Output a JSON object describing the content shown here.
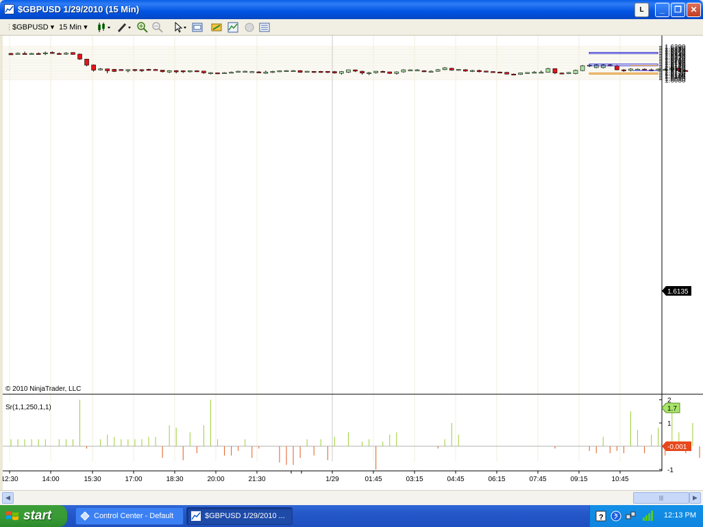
{
  "window": {
    "title": "$GBPUSD  1/29/2010 (15 Min)",
    "l_button": "L",
    "minimize": "_",
    "maximize": "❐",
    "close": "✕"
  },
  "toolbar": {
    "instrument": "$GBPUSD",
    "interval": "15 Min",
    "icons": [
      "candlestick-style-icon",
      "draw-pencil-icon",
      "zoom-in-icon",
      "zoom-out-icon",
      "pointer-icon",
      "data-box-icon",
      "strategies-icon",
      "indicators-icon",
      "properties-icon",
      "chart-trader-icon"
    ]
  },
  "chart": {
    "copyright": "© 2010 NinjaTrader, LLC",
    "indicator_label": "Sr(1,1,250,1,1)",
    "current_price": "1.6135",
    "indicator_pos_value": "1.7",
    "indicator_neg_value": "-0.001",
    "colors": {
      "up": "#a6e3a1",
      "down": "#e0161a",
      "rect_blue": "#2b2bd9",
      "rect_orange": "#e08a17",
      "hist_up": "#9acd32",
      "hist_down": "#e25a1c"
    }
  },
  "chart_data": {
    "type": "candlestick",
    "y_ticks": [
      "1.6290",
      "1.6280",
      "1.6270",
      "1.6260",
      "1.6250",
      "1.6240",
      "1.6230",
      "1.6220",
      "1.6210",
      "1.6200",
      "1.6190",
      "1.6180",
      "1.6170",
      "1.6160",
      "1.6150",
      "1.6140",
      "1.6130",
      "1.6120",
      "1.6110",
      "1.6100",
      "1.6090",
      "1.6080"
    ],
    "x_ticks": [
      "12:30",
      "14:00",
      "15:30",
      "17:00",
      "18:30",
      "20:00",
      "21:30",
      "1/29",
      "01:45",
      "03:15",
      "04:45",
      "06:15",
      "07:45",
      "09:15",
      "10:45"
    ],
    "indicator_y_ticks": [
      "2",
      "1",
      "-1"
    ],
    "ylim": [
      1.6075,
      1.6295
    ],
    "candles": [
      [
        1.6246,
        1.625,
        1.6236,
        1.6238
      ],
      [
        1.624,
        1.6252,
        1.6238,
        1.6247
      ],
      [
        1.6246,
        1.6258,
        1.6242,
        1.6245
      ],
      [
        1.6245,
        1.625,
        1.624,
        1.6246
      ],
      [
        1.6246,
        1.6252,
        1.6242,
        1.6245
      ],
      [
        1.6245,
        1.6258,
        1.6236,
        1.625
      ],
      [
        1.6253,
        1.6259,
        1.6244,
        1.6246
      ],
      [
        1.6246,
        1.6252,
        1.624,
        1.6244
      ],
      [
        1.6242,
        1.6254,
        1.6238,
        1.6248
      ],
      [
        1.6252,
        1.6254,
        1.6238,
        1.624
      ],
      [
        1.6242,
        1.6245,
        1.6206,
        1.621
      ],
      [
        1.621,
        1.6212,
        1.6165,
        1.6172
      ],
      [
        1.6173,
        1.6176,
        1.6131,
        1.614
      ],
      [
        1.6142,
        1.6153,
        1.6138,
        1.6148
      ],
      [
        1.6148,
        1.615,
        1.612,
        1.6136
      ],
      [
        1.6145,
        1.6148,
        1.6128,
        1.6132
      ],
      [
        1.6144,
        1.6146,
        1.6136,
        1.614
      ],
      [
        1.6138,
        1.6146,
        1.6126,
        1.6143
      ],
      [
        1.6144,
        1.6147,
        1.6132,
        1.614
      ],
      [
        1.6143,
        1.6146,
        1.6128,
        1.614
      ],
      [
        1.6145,
        1.6149,
        1.6137,
        1.6141
      ],
      [
        1.6144,
        1.6148,
        1.614,
        1.6141
      ],
      [
        1.614,
        1.6142,
        1.6125,
        1.613
      ],
      [
        1.6128,
        1.614,
        1.6122,
        1.6137
      ],
      [
        1.6137,
        1.614,
        1.612,
        1.6129
      ],
      [
        1.6136,
        1.6138,
        1.6122,
        1.613
      ],
      [
        1.6131,
        1.6138,
        1.6125,
        1.6136
      ],
      [
        1.6136,
        1.6139,
        1.613,
        1.6133
      ],
      [
        1.6134,
        1.6135,
        1.6117,
        1.6123
      ],
      [
        1.6121,
        1.6127,
        1.6113,
        1.6124
      ],
      [
        1.6123,
        1.6124,
        1.612,
        1.6122
      ],
      [
        1.6124,
        1.6127,
        1.6118,
        1.6124
      ],
      [
        1.6125,
        1.6131,
        1.6122,
        1.6127
      ],
      [
        1.6128,
        1.6136,
        1.6126,
        1.6133
      ],
      [
        1.6132,
        1.6137,
        1.6127,
        1.6133
      ],
      [
        1.6131,
        1.6134,
        1.613,
        1.6131
      ],
      [
        1.6129,
        1.6134,
        1.6122,
        1.6128
      ],
      [
        1.612,
        1.6137,
        1.6117,
        1.6128
      ],
      [
        1.6128,
        1.6136,
        1.6122,
        1.6132
      ],
      [
        1.6133,
        1.6138,
        1.6128,
        1.6136
      ],
      [
        1.6137,
        1.614,
        1.6132,
        1.6137
      ],
      [
        1.6137,
        1.6141,
        1.6131,
        1.6137
      ],
      [
        1.6137,
        1.6139,
        1.6124,
        1.6126
      ],
      [
        1.6129,
        1.6135,
        1.6126,
        1.6133
      ],
      [
        1.6132,
        1.6134,
        1.6123,
        1.6129
      ],
      [
        1.6132,
        1.6135,
        1.6123,
        1.6126
      ],
      [
        1.6132,
        1.6134,
        1.6122,
        1.6128
      ],
      [
        1.6131,
        1.6135,
        1.6118,
        1.6122
      ],
      [
        1.612,
        1.6134,
        1.6112,
        1.6131
      ],
      [
        1.6126,
        1.6144,
        1.6122,
        1.6142
      ],
      [
        1.6142,
        1.6143,
        1.6128,
        1.6134
      ],
      [
        1.6133,
        1.6136,
        1.6112,
        1.6122
      ],
      [
        1.6122,
        1.6129,
        1.6109,
        1.6124
      ],
      [
        1.6124,
        1.6134,
        1.6119,
        1.6133
      ],
      [
        1.6132,
        1.6137,
        1.6126,
        1.6129
      ],
      [
        1.6129,
        1.613,
        1.6117,
        1.6119
      ],
      [
        1.6119,
        1.6132,
        1.6112,
        1.6129
      ],
      [
        1.6129,
        1.6146,
        1.6124,
        1.6142
      ],
      [
        1.6142,
        1.6145,
        1.6137,
        1.6142
      ],
      [
        1.6142,
        1.6146,
        1.6137,
        1.6142
      ],
      [
        1.6136,
        1.6139,
        1.6128,
        1.6134
      ],
      [
        1.6132,
        1.6138,
        1.6127,
        1.6133
      ],
      [
        1.6133,
        1.6147,
        1.613,
        1.6143
      ],
      [
        1.6143,
        1.6159,
        1.614,
        1.6155
      ],
      [
        1.6152,
        1.6155,
        1.6137,
        1.614
      ],
      [
        1.6139,
        1.6147,
        1.6136,
        1.6145
      ],
      [
        1.6143,
        1.6146,
        1.613,
        1.6134
      ],
      [
        1.6134,
        1.6142,
        1.6128,
        1.6138
      ],
      [
        1.6138,
        1.6143,
        1.6126,
        1.613
      ],
      [
        1.6134,
        1.6136,
        1.6128,
        1.6131
      ],
      [
        1.6131,
        1.6133,
        1.6124,
        1.6128
      ],
      [
        1.6128,
        1.6131,
        1.6122,
        1.6126
      ],
      [
        1.6126,
        1.6128,
        1.6113,
        1.6115
      ],
      [
        1.6115,
        1.6118,
        1.6111,
        1.6114
      ],
      [
        1.6113,
        1.6125,
        1.611,
        1.6123
      ],
      [
        1.6123,
        1.6126,
        1.6117,
        1.6125
      ],
      [
        1.6125,
        1.6134,
        1.612,
        1.6127
      ],
      [
        1.6127,
        1.6137,
        1.6123,
        1.6127
      ],
      [
        1.6126,
        1.6155,
        1.6124,
        1.615
      ],
      [
        1.615,
        1.6151,
        1.6115,
        1.6122
      ],
      [
        1.6122,
        1.6125,
        1.6117,
        1.612
      ],
      [
        1.6118,
        1.6128,
        1.6115,
        1.6125
      ],
      [
        1.6118,
        1.6143,
        1.6114,
        1.6139
      ],
      [
        1.6137,
        1.6173,
        1.6134,
        1.6168
      ],
      [
        1.6166,
        1.6176,
        1.616,
        1.6172
      ],
      [
        1.6156,
        1.6178,
        1.6152,
        1.6173
      ],
      [
        1.6156,
        1.6178,
        1.6151,
        1.6173
      ],
      [
        1.6173,
        1.6179,
        1.617,
        1.6169
      ],
      [
        1.6169,
        1.6174,
        1.6139,
        1.6142
      ],
      [
        1.6142,
        1.6146,
        1.613,
        1.6138
      ],
      [
        1.6138,
        1.6152,
        1.6133,
        1.6147
      ],
      [
        1.6145,
        1.615,
        1.614,
        1.6146
      ],
      [
        1.6146,
        1.6151,
        1.6137,
        1.6142
      ],
      [
        1.6142,
        1.615,
        1.6136,
        1.6138
      ],
      [
        1.6138,
        1.6151,
        1.6132,
        1.6146
      ],
      [
        1.6143,
        1.6152,
        1.6139,
        1.6145
      ],
      [
        1.6145,
        1.6163,
        1.6137,
        1.6152
      ],
      [
        1.6153,
        1.6156,
        1.6132,
        1.6138
      ],
      [
        1.6138,
        1.6142,
        1.6132,
        1.6136
      ]
    ],
    "indicator": [
      0.3,
      0.3,
      0.3,
      0.3,
      0.3,
      0.3,
      0,
      0.3,
      0.3,
      0.3,
      2.0,
      -0.1,
      0,
      0.3,
      0.5,
      0.4,
      0.3,
      0.3,
      0.3,
      0.3,
      0.4,
      0.4,
      -0.5,
      0.9,
      0.8,
      -0.6,
      0.6,
      -0.3,
      0.9,
      2.0,
      0.3,
      -0.4,
      -0.4,
      -0.2,
      0.3,
      -0.5,
      -0.1,
      0,
      0,
      -0.7,
      -0.8,
      -0.8,
      -0.5,
      0.3,
      -0.4,
      0.3,
      -0.6,
      0.4,
      0,
      0.6,
      0,
      0.2,
      0.3,
      -1.0,
      0.2,
      0.5,
      0.6,
      0,
      0,
      0,
      0,
      0,
      -0.1,
      0.3,
      1.0,
      0.5,
      0,
      0,
      0,
      0,
      0,
      0,
      0,
      0,
      0,
      0,
      0,
      0,
      0,
      -0.1,
      0,
      0,
      0,
      0,
      -0.2,
      -0.3,
      0.4,
      -0.3,
      -0.2,
      -0.3,
      1.5,
      0.7,
      -0.3,
      0.5,
      0.8,
      -0.4,
      1.7,
      0.6,
      -0.3,
      1.0,
      -0.5,
      1.8
    ]
  },
  "taskbar": {
    "start_label": "start",
    "tasks": [
      {
        "label": "Control Center - Default"
      },
      {
        "label": "$GBPUSD  1/29/2010 ..."
      }
    ],
    "clock": "12:13 PM"
  }
}
